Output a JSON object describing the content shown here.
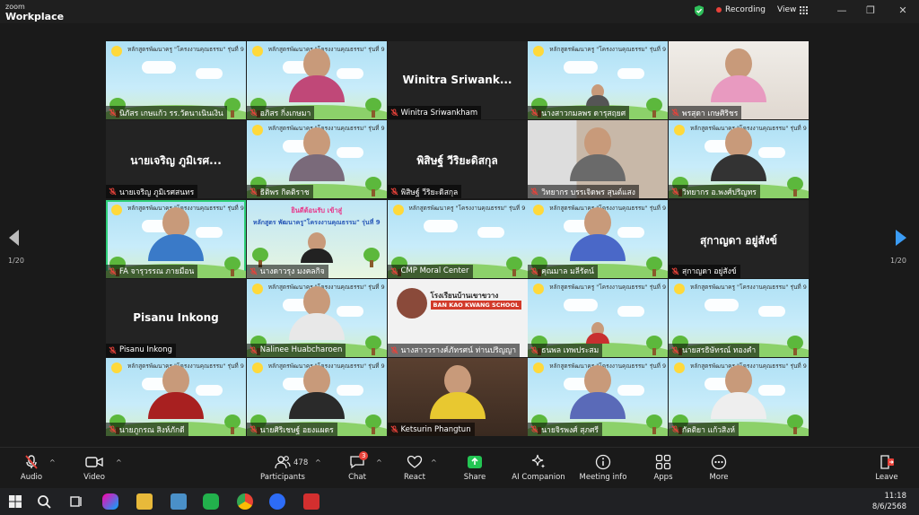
{
  "titlebar": {
    "logo_top": "zoom",
    "logo_bottom": "Workplace",
    "recording_label": "Recording",
    "view_label": "View"
  },
  "pagination": {
    "left": "1/20",
    "right": "1/20"
  },
  "tile_banner": "หลักสูตรพัฒนาครู \"โครงงานคุณธรรม\" รุ่นที่ 9",
  "tiles": [
    {
      "name": "นิภัสร เกษแก้ว รร.วัดนาเนินเงิน",
      "type": "sky-empty"
    },
    {
      "name": "อภิสร กิ่งเกษมา",
      "type": "sky-person",
      "shirt": "#c04878"
    },
    {
      "name": "Winitra Sriwankham",
      "big": "Winitra  Sriwank...",
      "type": "dark"
    },
    {
      "name": "นางสาวกมลพร ดารุสฤยศ",
      "type": "sky-small"
    },
    {
      "name": "พรสุดา เกษศิริชร",
      "type": "photo-person",
      "shirt": "#e89ac0"
    },
    {
      "name": "นายเจริญ ภูมิเรศสนทร",
      "big": "นายเจริญ ภูมิเรศ...",
      "type": "dark"
    },
    {
      "name": "ธิติพร กิตติราช",
      "type": "sky-person",
      "shirt": "#7a6a7a"
    },
    {
      "name": "พิสิษฐ์ วีริยะดิสกุล",
      "big": "พิสิษฐ์  วีริยะดิสกุล",
      "type": "dark"
    },
    {
      "name": "วิทยากร บรรเจิดพร สุนต์แสง",
      "type": "photo-glasses",
      "shirt": "#6a6a6a"
    },
    {
      "name": "วิทยากร อ.พงศ์ปริญทร",
      "type": "sky-person",
      "shirt": "#333"
    },
    {
      "name": "FA จารุวรรณ ภายมือน",
      "type": "sky-person",
      "shirt": "#3a7ac8",
      "active": true
    },
    {
      "name": "นางดาวรุง มงคลกิจ",
      "type": "poster",
      "poster_line1": "ยินดีต้อนรับ เข้าสู่",
      "poster_line2": "หลักสูตร พัฒนาครู\"โครงงานคุณธรรม\" รุ่นที่ 9"
    },
    {
      "name": "CMP Moral Center",
      "type": "sky-empty"
    },
    {
      "name": "คุณมาล มลีรัตน์",
      "type": "sky-person",
      "shirt": "#4a68c8"
    },
    {
      "name": "สุกาญดา อยู่สังข์",
      "big": "สุกาญดา อยู่สังข์",
      "type": "dark"
    },
    {
      "name": "Pisanu Inkong",
      "big": "Pisanu Inkong",
      "type": "dark"
    },
    {
      "name": "Nalinee Huabcharoen",
      "type": "sky-person",
      "shirt": "#e8e8e8"
    },
    {
      "name": "นางสาววรางค์ภัทรศน์ ท่านปริญญา",
      "type": "school",
      "school_th": "โรงเรียนบ้านเขาขวาง",
      "school_en": "BAN KAO KWANG SCHOOL"
    },
    {
      "name": "ธนพล เทพประสม",
      "type": "sky-small-red"
    },
    {
      "name": "นายสรธิษัทรณ์ ทองคำ",
      "type": "sky-empty"
    },
    {
      "name": "นายภูกรณ สิงห์ภักดี",
      "type": "sky-person",
      "shirt": "#a82020"
    },
    {
      "name": "นายศิริเชษฐ์ อยงแผดร",
      "type": "sky-person",
      "shirt": "#2a2a2a"
    },
    {
      "name": "Ketsurin Phangtun",
      "type": "room",
      "shirt": "#e8c830"
    },
    {
      "name": "นายจิรพงศ์ สุภศรี",
      "type": "sky-person",
      "shirt": "#5a6ab8"
    },
    {
      "name": "กัตติยา แก้วสิงห์",
      "type": "sky-person",
      "shirt": "#eee"
    }
  ],
  "toolbar": {
    "audio": "Audio",
    "video": "Video",
    "participants": "Participants",
    "participants_count": "478",
    "chat": "Chat",
    "chat_badge": "3",
    "react": "React",
    "share": "Share",
    "ai": "AI Companion",
    "meeting_info": "Meeting info",
    "apps": "Apps",
    "more": "More",
    "leave": "Leave"
  },
  "taskbar": {
    "time": "11:18",
    "date": "8/6/2568"
  },
  "colors": {
    "accent_green": "#2fd07a",
    "share_green": "#23c553",
    "record_red": "#e8423a",
    "arrow_blue": "#3b9cf5"
  }
}
